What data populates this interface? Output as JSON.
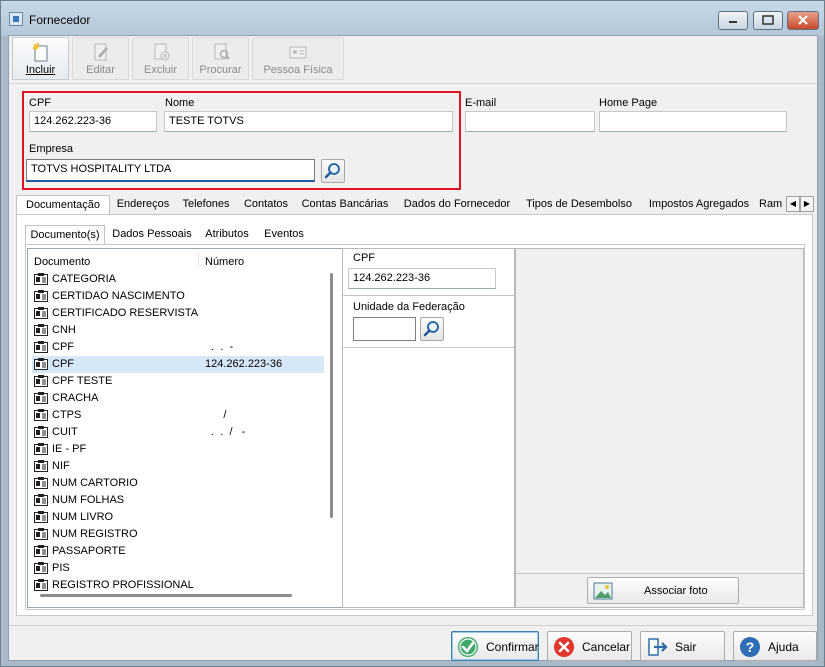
{
  "window": {
    "title": "Fornecedor"
  },
  "toolbar": {
    "incluir": "Incluir",
    "editar": "Editar",
    "excluir": "Excluir",
    "procurar": "Procurar",
    "pessoa_fisica": "Pessoa Física"
  },
  "form": {
    "cpf_label": "CPF",
    "cpf_value": "124.262.223-36",
    "nome_label": "Nome",
    "nome_value": "TESTE TOTVS",
    "email_label": "E-mail",
    "email_value": "",
    "homepage_label": "Home Page",
    "homepage_value": "",
    "empresa_label": "Empresa",
    "empresa_value": "TOTVS HOSPITALITY LTDA"
  },
  "tabs": [
    "Documentação",
    "Endereços",
    "Telefones",
    "Contatos",
    "Contas Bancárias",
    "Dados do Fornecedor",
    "Tipos de Desembolso",
    "Impostos Agregados",
    "Ram"
  ],
  "subtabs": [
    "Documento(s)",
    "Dados Pessoais",
    "Atributos",
    "Eventos"
  ],
  "doc_list": {
    "col_documento": "Documento",
    "col_numero": "Número",
    "rows": [
      {
        "name": "CATEGORIA",
        "num": ""
      },
      {
        "name": "CERTIDAO NASCIMENTO",
        "num": ""
      },
      {
        "name": "CERTIFICADO RESERVISTA",
        "num": ""
      },
      {
        "name": "CNH",
        "num": ""
      },
      {
        "name": "CPF",
        "num": "  .  .  -"
      },
      {
        "name": "CPF",
        "num": "124.262.223-36"
      },
      {
        "name": "CPF TESTE",
        "num": ""
      },
      {
        "name": "CRACHA",
        "num": ""
      },
      {
        "name": "CTPS",
        "num": "      /"
      },
      {
        "name": "CUIT",
        "num": "  .  .  /   -"
      },
      {
        "name": "IE - PF",
        "num": ""
      },
      {
        "name": "NIF",
        "num": ""
      },
      {
        "name": "NUM CARTORIO",
        "num": ""
      },
      {
        "name": "NUM FOLHAS",
        "num": ""
      },
      {
        "name": "NUM LIVRO",
        "num": ""
      },
      {
        "name": "NUM REGISTRO",
        "num": ""
      },
      {
        "name": "PASSAPORTE",
        "num": ""
      },
      {
        "name": "PIS",
        "num": ""
      },
      {
        "name": "REGISTRO PROFISSIONAL",
        "num": ""
      }
    ]
  },
  "detail": {
    "cpf_label": "CPF",
    "cpf_value": "124.262.223-36",
    "uf_label": "Unidade da Federação",
    "uf_value": ""
  },
  "photo": {
    "associar_label": "Associar foto"
  },
  "buttons": {
    "confirmar": "Confirmar",
    "cancelar": "Cancelar",
    "sair": "Sair",
    "ajuda": "Ajuda"
  }
}
